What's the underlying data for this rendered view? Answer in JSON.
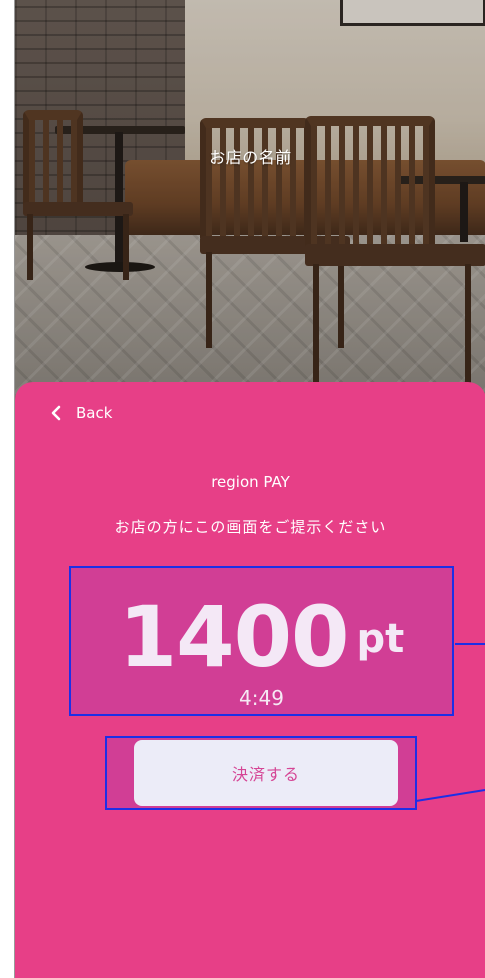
{
  "header": {
    "shop_name": "お店の名前"
  },
  "panel": {
    "back_label": "Back",
    "service_name": "region PAY",
    "instruction": "お店の方にこの画面をご提示ください",
    "points": {
      "value": "1400",
      "unit": "pt",
      "timer": "4:49"
    },
    "pay_button_label": "決済する"
  },
  "icons": {
    "back": "chevron-left-icon"
  },
  "colors": {
    "panel_background": "#e73f87",
    "points_box": "#d13e95",
    "highlight_outline": "#1d2fe6",
    "button_background": "#ececf8",
    "button_text": "#d54595"
  }
}
